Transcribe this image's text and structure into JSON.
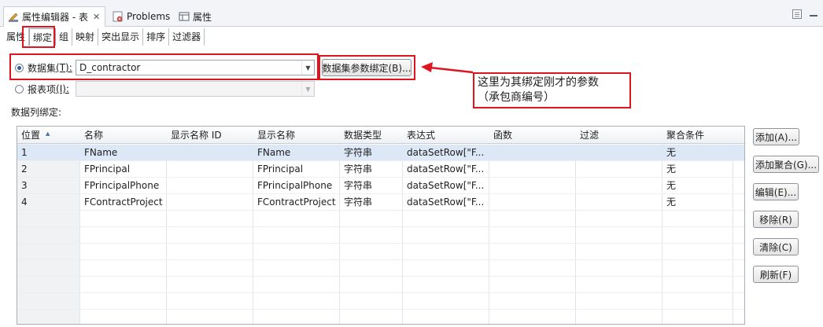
{
  "window": {
    "tabs": [
      {
        "label": "属性编辑器 - 表",
        "icon": "pencil-icon",
        "close": "✕"
      },
      {
        "label": "Problems",
        "icon": "problems-icon"
      },
      {
        "label": "属性",
        "icon": "properties-icon"
      }
    ],
    "minimize_icon": "minimize-icon"
  },
  "subtabs": [
    "属性",
    "绑定",
    "组",
    "映射",
    "突出显示",
    "排序",
    "过滤器"
  ],
  "binding": {
    "dataset_label": "数据集",
    "dataset_mnemonic": "(T):",
    "dataset_value": "D_contractor",
    "param_binding_button": "数据集参数绑定(B)...",
    "report_item_label": "报表项",
    "report_item_mnemonic": "(I):",
    "report_item_value": "",
    "columns_label": "数据列绑定:"
  },
  "annotation": {
    "line1": "这里为其绑定刚才的参数",
    "line2": "（承包商编号）"
  },
  "table": {
    "headers": [
      "位置",
      "名称",
      "显示名称 ID",
      "显示名称",
      "数据类型",
      "表达式",
      "函数",
      "过滤",
      "聚合条件"
    ],
    "rows": [
      [
        "1",
        "FName",
        "",
        "FName",
        "字符串",
        "dataSetRow[\"F...",
        "",
        "",
        "无"
      ],
      [
        "2",
        "FPrincipal",
        "",
        "FPrincipal",
        "字符串",
        "dataSetRow[\"F...",
        "",
        "",
        "无"
      ],
      [
        "3",
        "FPrincipalPhone",
        "",
        "FPrincipalPhone",
        "字符串",
        "dataSetRow[\"F...",
        "",
        "",
        "无"
      ],
      [
        "4",
        "FContractProject",
        "",
        "FContractProject",
        "字符串",
        "dataSetRow[\"F...",
        "",
        "",
        "无"
      ]
    ]
  },
  "buttons": {
    "add": "添加(A)...",
    "add_aggregation": "添加聚合(G)...",
    "edit": "编辑(E)...",
    "remove": "移除(R)",
    "clear": "清除(C)",
    "refresh": "刷新(F)"
  },
  "colors": {
    "highlight": "#e0141e",
    "selection": "#dde8f7"
  }
}
